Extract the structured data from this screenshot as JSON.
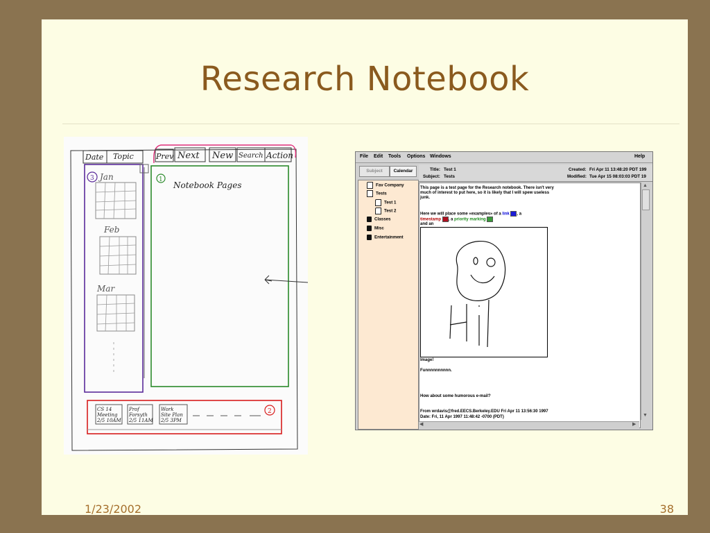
{
  "slide": {
    "title": "Research Notebook",
    "date": "1/23/2002",
    "page_number": "38"
  },
  "sketch": {
    "tabs": [
      "Date",
      "Topic"
    ],
    "toolbar": [
      "Prev",
      "Next",
      "New",
      "Search",
      "Action"
    ],
    "months": [
      "Jan",
      "Feb",
      "Mar"
    ],
    "pane_label": "Notebook Pages",
    "markers": [
      "1",
      "2",
      "3"
    ],
    "thumbnails": [
      {
        "line1": "CS 14",
        "line2": "Meeting",
        "line3": "2/5 10AM"
      },
      {
        "line1": "Prof",
        "line2": "Forsyth",
        "line3": "2/5 11AM"
      },
      {
        "line1": "Work",
        "line2": "Site Plan",
        "line3": "2/5 3PM"
      }
    ]
  },
  "app": {
    "menu": [
      "File",
      "Edit",
      "Tools",
      "Options",
      "Windows"
    ],
    "help": "Help",
    "tabs": {
      "subject": "Subject",
      "calendar": "Calendar"
    },
    "tree": [
      {
        "label": "Fav Company",
        "icon": "document-icon"
      },
      {
        "label": "Tests",
        "icon": "open-book-icon"
      },
      {
        "label": "Test 1",
        "icon": "document-icon"
      },
      {
        "label": "Test 2",
        "icon": "document-icon"
      },
      {
        "label": "Classes",
        "icon": "book-icon"
      },
      {
        "label": "Misc",
        "icon": "book-icon"
      },
      {
        "label": "Entertainment",
        "icon": "book-icon"
      }
    ],
    "header": {
      "title_label": "Title:",
      "title_value": "Test 1",
      "subject_label": "Subject:",
      "subject_value": "Tests",
      "created_label": "Created:",
      "created_value": "Fri Apr 11 13:48:20 PDT 199",
      "modified_label": "Modified:",
      "modified_value": "Tue Apr 15 08:03:03 PDT 19"
    },
    "content": {
      "para1_l1": "This page is a test page for the Research notebook.  There isn't very",
      "para1_l2": "much of interest to put here, so it is likely that I will spew useless",
      "para1_l3": "junk.",
      "para2_a": "Here we will place some «examples» of a ",
      "link": "link",
      "para2_b": ", a",
      "timestamp": "timestamp",
      "para2_c": ", a ",
      "priority": "priority marking",
      "para2_d": "and an",
      "image_caption": "Image!",
      "funny": "Funnnnnnnnnn.",
      "email_q": "How about some humorous e-mail?",
      "email_from": "From wrdavis@fred.EECS.Berkeley.EDU Fri Apr 11 13:56:30 1997",
      "email_date": "Date: Fri, 11 Apr 1997 11:48:42 -0700 (PDT)"
    },
    "colors": {
      "link": "#0000d8",
      "timestamp": "#b00000",
      "priority": "#1a8a1a",
      "tree_bg": "#fde9d2"
    }
  }
}
